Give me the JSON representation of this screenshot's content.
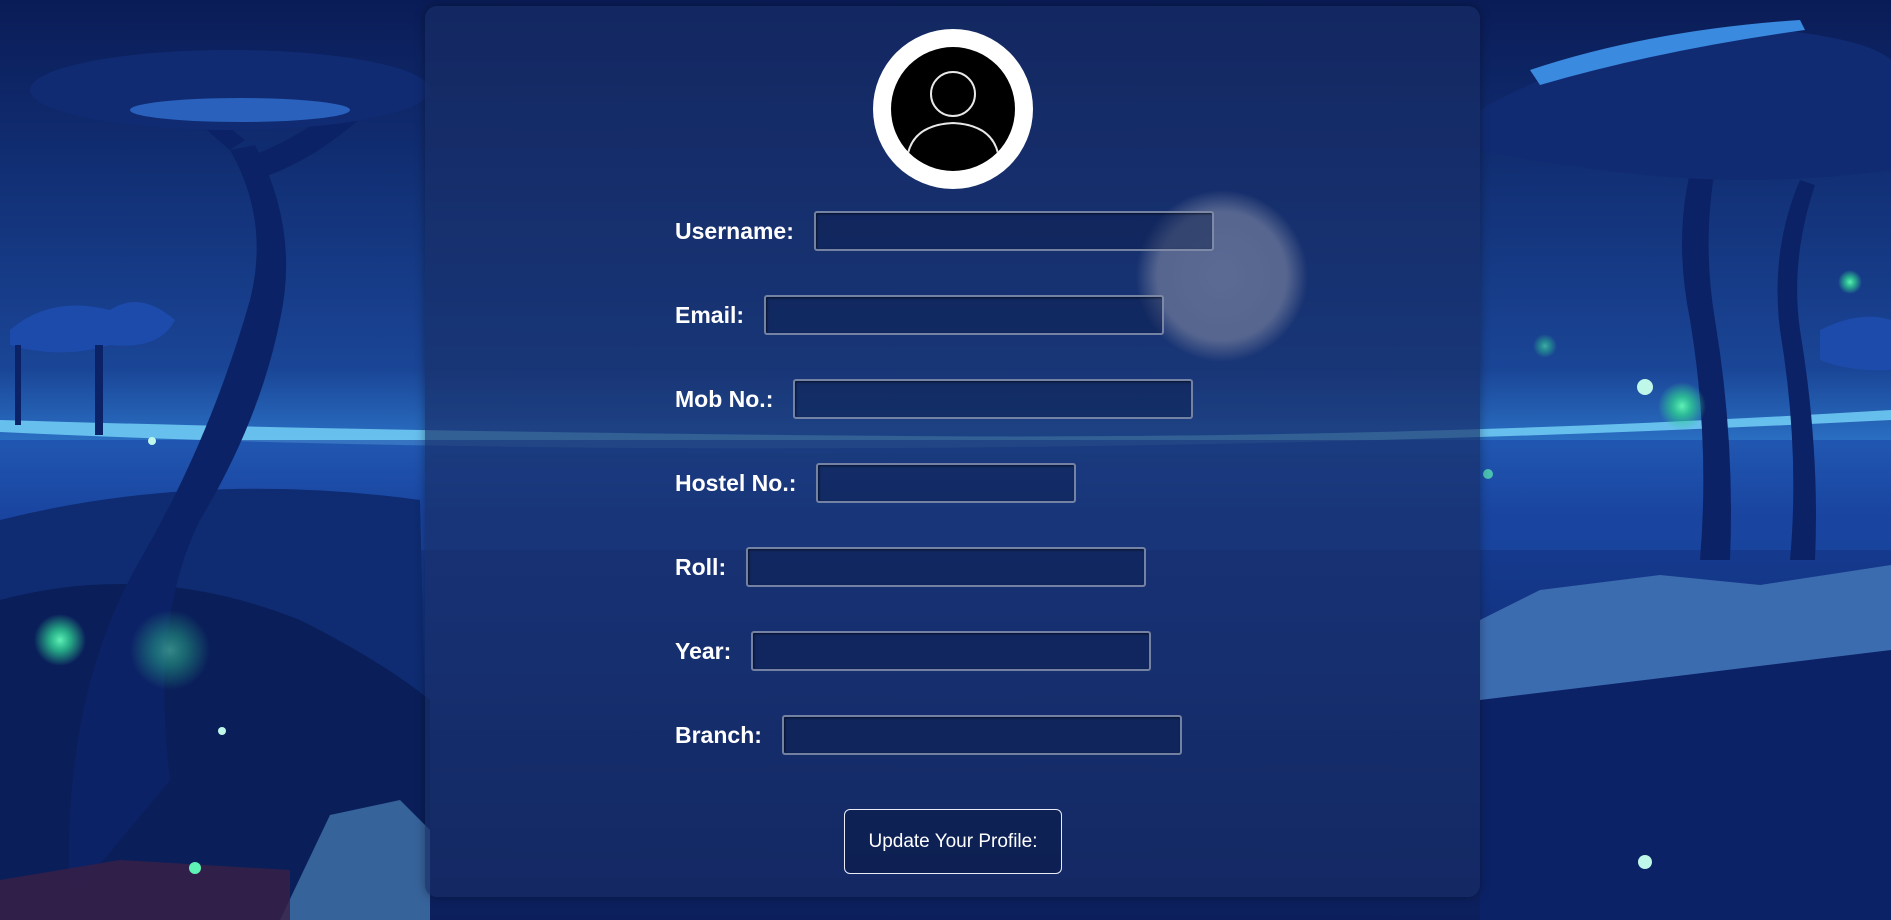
{
  "profile_form": {
    "fields": [
      {
        "label": "Username:",
        "value": ""
      },
      {
        "label": "Email:",
        "value": ""
      },
      {
        "label": "Mob No.:",
        "value": ""
      },
      {
        "label": "Hostel No.:",
        "value": ""
      },
      {
        "label": "Roll:",
        "value": ""
      },
      {
        "label": "Year:",
        "value": ""
      },
      {
        "label": "Branch:",
        "value": ""
      }
    ],
    "submit_label": "Update Your Profile:"
  },
  "icons": {
    "avatar": "user-avatar-icon"
  },
  "colors": {
    "background": "#0b1f55",
    "label_text": "#ffffff",
    "input_border": "#969fb9",
    "avatar_ring": "#ffffff",
    "moon": "#cfd3de"
  }
}
